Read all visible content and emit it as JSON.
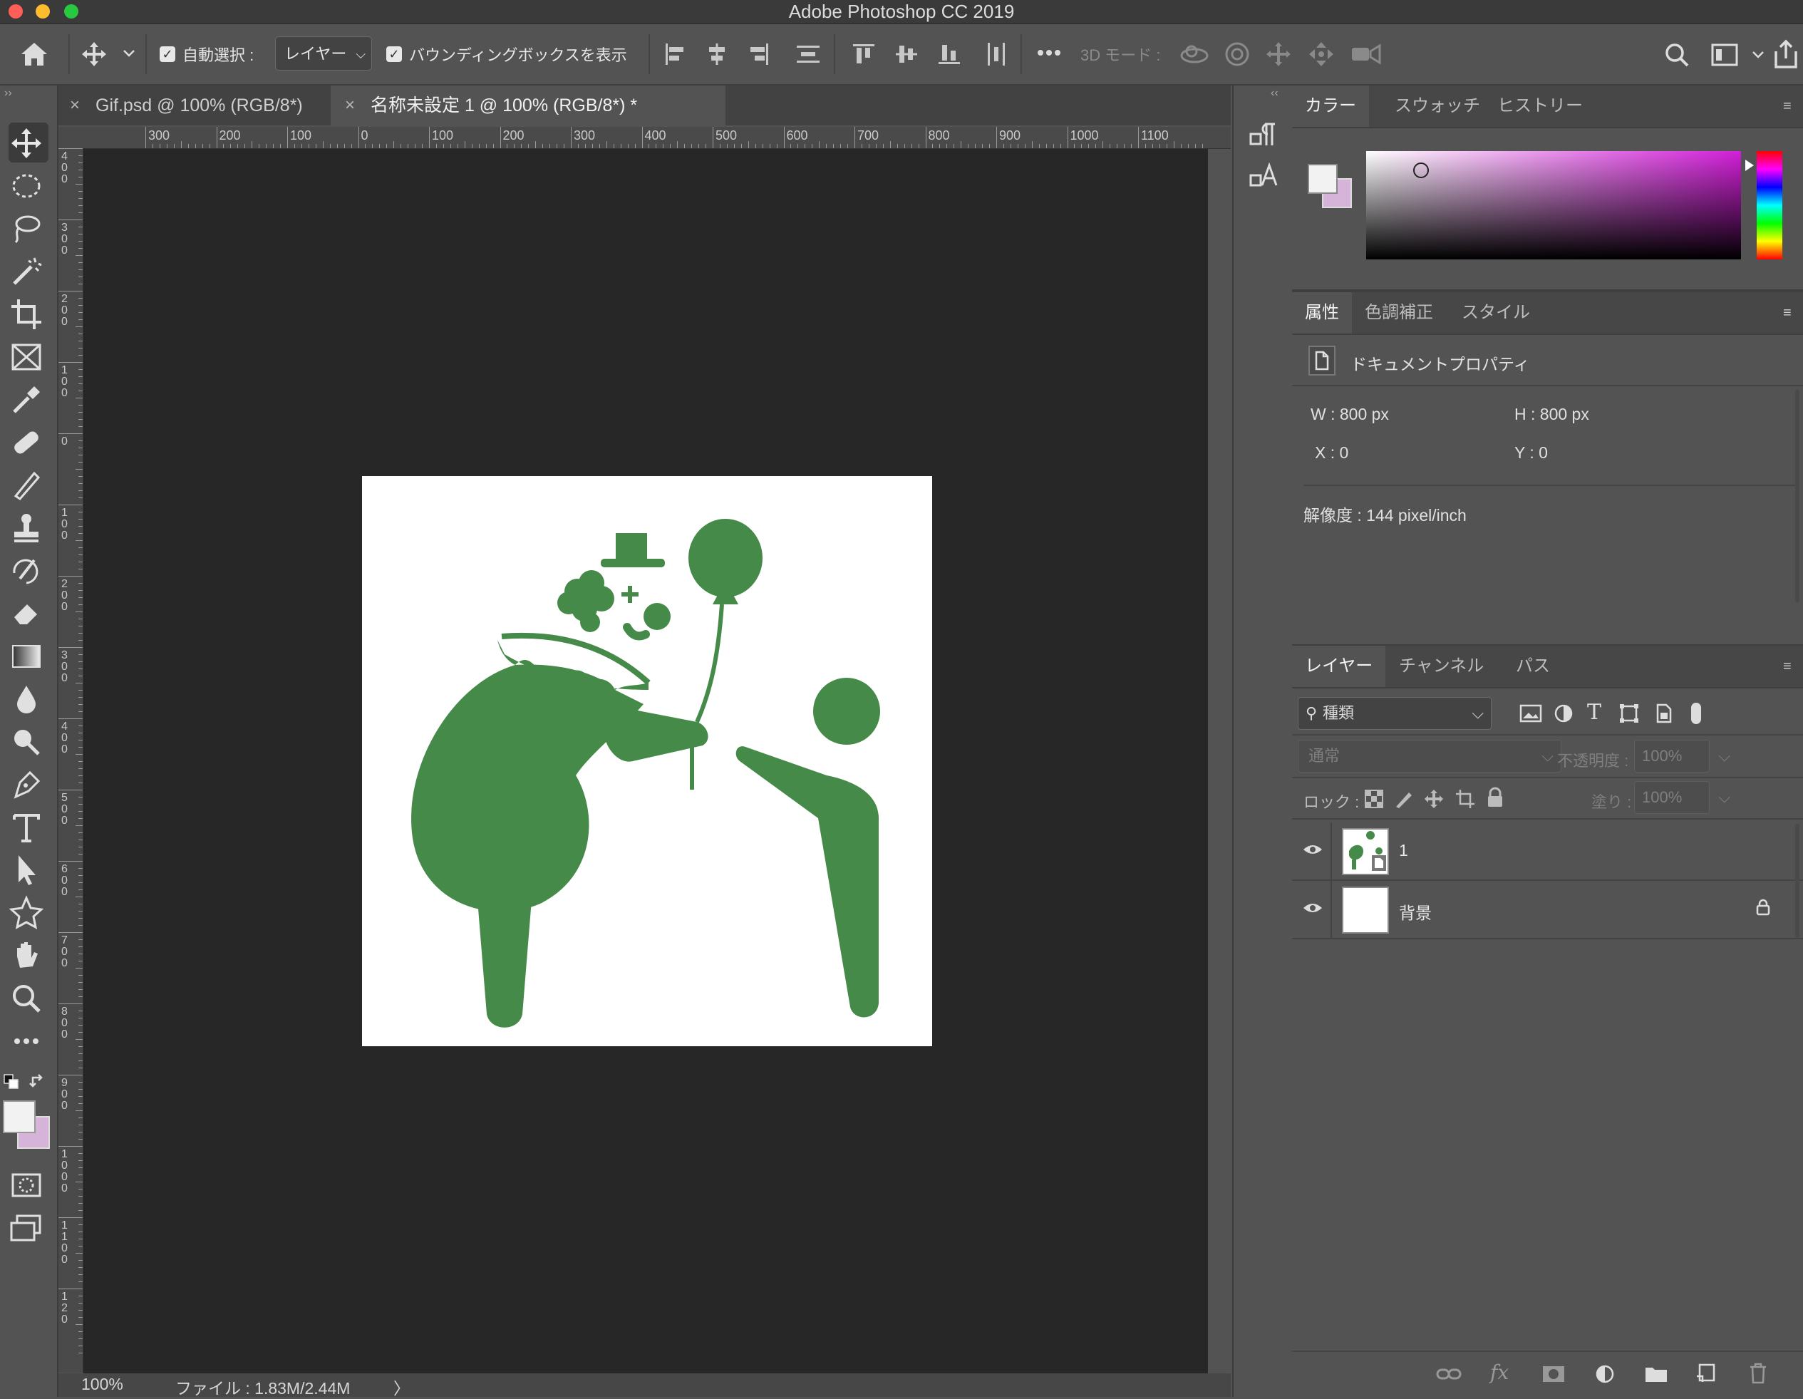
{
  "window": {
    "title": "Adobe Photoshop CC 2019",
    "traffic_colors": [
      "#ff5f57",
      "#febc2e",
      "#28c840"
    ]
  },
  "options_bar": {
    "auto_select_label": "自動選択 :",
    "auto_select_target": "レイヤー",
    "show_bbox_label": "バウンディングボックスを表示",
    "mode_3d_label": "3D モード :"
  },
  "document_tabs": [
    {
      "close": "×",
      "label": "Gif.psd @ 100% (RGB/8*)"
    },
    {
      "close": "×",
      "label": "名称未設定 1 @ 100% (RGB/8*) *"
    }
  ],
  "rulers": {
    "horizontal": [
      "300",
      "200",
      "100",
      "0",
      "100",
      "200",
      "300",
      "400",
      "500",
      "600",
      "700",
      "800",
      "900",
      "1000",
      "1100"
    ],
    "vertical": [
      "4\n0\n0",
      "3\n0\n0",
      "2\n0\n0",
      "1\n0\n0",
      "0",
      "1\n0\n0",
      "2\n0\n0",
      "3\n0\n0",
      "4\n0\n0",
      "5\n0\n0",
      "6\n0\n0",
      "7\n0\n0",
      "8\n0\n0",
      "9\n0\n0",
      "1\n0\n0\n0",
      "1\n1\n0\n0",
      "1\n2\n0"
    ]
  },
  "status_bar": {
    "zoom": "100%",
    "file_info": "ファイル : 1.83M/2.44M",
    "arrow": "〉"
  },
  "colors": {
    "artwork_green": "#468a4a",
    "swatch_fg": "#f2f2f2",
    "swatch_bg": "#d6b3d8",
    "picker_hue": "#d21fd8"
  },
  "color_panel": {
    "tabs": [
      "カラー",
      "スウォッチ",
      "ヒストリー"
    ]
  },
  "properties_panel": {
    "tabs": [
      "属性",
      "色調補正",
      "スタイル"
    ],
    "doc_title": "ドキュメントプロパティ",
    "w": "W : 800 px",
    "h": "H : 800 px",
    "x": "X : 0",
    "y": "Y : 0",
    "resolution": "解像度 : 144 pixel/inch"
  },
  "layers_panel": {
    "tabs": [
      "レイヤー",
      "チャンネル",
      "パス"
    ],
    "filter_label": "種類",
    "blend_mode": "通常",
    "opacity_label": "不透明度 :",
    "opacity_value": "100%",
    "lock_label": "ロック :",
    "fill_label": "塗り :",
    "fill_value": "100%",
    "layers": [
      {
        "name": "1",
        "visible": true,
        "locked": false
      },
      {
        "name": "背景",
        "visible": true,
        "locked": true
      }
    ]
  }
}
